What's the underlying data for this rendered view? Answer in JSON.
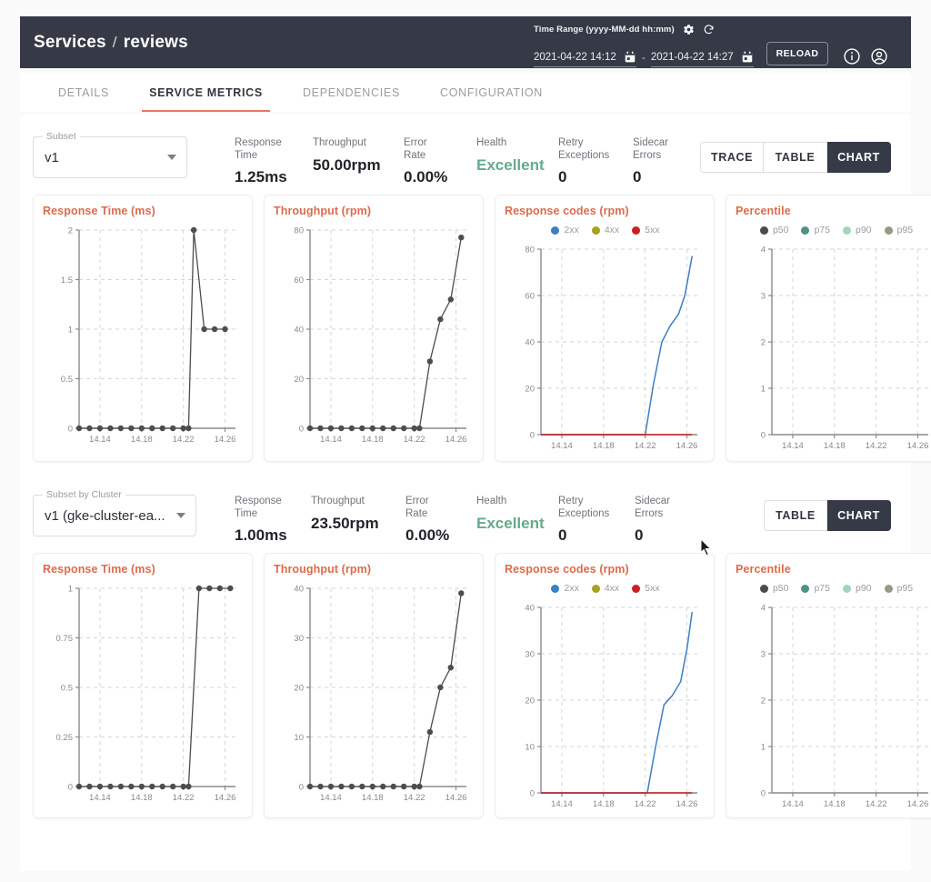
{
  "header": {
    "breadcrumb_root": "Services",
    "breadcrumb_sep": "/",
    "breadcrumb_current": "reviews",
    "time_range_label": "Time Range (yyyy-MM-dd hh:mm)",
    "date_from": "2021-04-22 14:12",
    "date_to": "2021-04-22 14:27",
    "dash": "-",
    "reload_label": "RELOAD",
    "icons": [
      "gear-icon",
      "refresh-icon",
      "calendar-icon",
      "info-icon",
      "account-icon"
    ]
  },
  "tabs": [
    {
      "label": "DETAILS",
      "active": false
    },
    {
      "label": "SERVICE METRICS",
      "active": true
    },
    {
      "label": "DEPENDENCIES",
      "active": false
    },
    {
      "label": "CONFIGURATION",
      "active": false
    }
  ],
  "section_subset": {
    "select_legend": "Subset",
    "select_value": "v1",
    "metrics": [
      {
        "label": "Response Time",
        "value": "1.25ms"
      },
      {
        "label": "Throughput",
        "value": "50.00rpm"
      },
      {
        "label": "Error Rate",
        "value": "0.00%"
      },
      {
        "label": "Health",
        "value": "Excellent"
      },
      {
        "label": "Retry Exceptions",
        "value": "0"
      },
      {
        "label": "Sidecar Errors",
        "value": "0"
      }
    ],
    "toggles": [
      {
        "label": "TRACE",
        "selected": false
      },
      {
        "label": "TABLE",
        "selected": false
      },
      {
        "label": "CHART",
        "selected": true
      }
    ]
  },
  "section_cluster": {
    "select_legend": "Subset by Cluster",
    "select_value": "v1 (gke-cluster-ea...",
    "metrics": [
      {
        "label": "Response Time",
        "value": "1.00ms"
      },
      {
        "label": "Throughput",
        "value": "23.50rpm"
      },
      {
        "label": "Error Rate",
        "value": "0.00%"
      },
      {
        "label": "Health",
        "value": "Excellent"
      },
      {
        "label": "Retry Exceptions",
        "value": "0"
      },
      {
        "label": "Sidecar Errors",
        "value": "0"
      }
    ],
    "toggles": [
      {
        "label": "TABLE",
        "selected": false
      },
      {
        "label": "CHART",
        "selected": true
      }
    ]
  },
  "colors": {
    "accent": "#dd6b4b",
    "topbar": "#363a47",
    "health": "#64ab8c",
    "series_dark": "#4d4d4d",
    "c2xx": "#3b7fc4",
    "c4xx": "#a8a020",
    "c5xx": "#cc2020",
    "p50": "#4d4a47",
    "p75": "#4f9283",
    "p90": "#9fd7b9",
    "p95": "#9b9885"
  },
  "chart_data": [
    {
      "id": "subset-response-time",
      "type": "line",
      "title": "Response Time (ms)",
      "xlabel": "",
      "ylabel": "ms",
      "ylim": [
        0,
        2
      ],
      "yticks": [
        0,
        0.5,
        1,
        1.5,
        2
      ],
      "xticks": [
        "14.14",
        "14.18",
        "14.22",
        "14.26"
      ],
      "xlim": [
        14.12,
        14.27
      ],
      "grid": true,
      "legend": [],
      "series": [
        {
          "name": "response time",
          "color": "#4d4d4d",
          "markers": true,
          "x": [
            14.12,
            14.13,
            14.14,
            14.15,
            14.16,
            14.17,
            14.18,
            14.19,
            14.2,
            14.21,
            14.22,
            14.225,
            14.23,
            14.24,
            14.25,
            14.26
          ],
          "values": [
            0,
            0,
            0,
            0,
            0,
            0,
            0,
            0,
            0,
            0,
            0,
            0,
            2,
            1,
            1,
            1
          ]
        }
      ]
    },
    {
      "id": "subset-throughput",
      "type": "line",
      "title": "Throughput (rpm)",
      "xlabel": "",
      "ylabel": "rpm",
      "ylim": [
        0,
        80
      ],
      "yticks": [
        0,
        20,
        40,
        60,
        80
      ],
      "xticks": [
        "14.14",
        "14.18",
        "14.22",
        "14.26"
      ],
      "xlim": [
        14.12,
        14.27
      ],
      "grid": true,
      "legend": [],
      "series": [
        {
          "name": "throughput",
          "color": "#4d4d4d",
          "markers": true,
          "x": [
            14.12,
            14.13,
            14.14,
            14.15,
            14.16,
            14.17,
            14.18,
            14.19,
            14.2,
            14.21,
            14.22,
            14.225,
            14.235,
            14.245,
            14.255,
            14.265
          ],
          "values": [
            0,
            0,
            0,
            0,
            0,
            0,
            0,
            0,
            0,
            0,
            0,
            0,
            27,
            44,
            52,
            77
          ]
        }
      ]
    },
    {
      "id": "subset-response-codes",
      "type": "line",
      "title": "Response codes (rpm)",
      "xlabel": "",
      "ylabel": "rpm",
      "ylim": [
        0,
        80
      ],
      "yticks": [
        0,
        20,
        40,
        60,
        80
      ],
      "xticks": [
        "14.14",
        "14.18",
        "14.22",
        "14.26"
      ],
      "xlim": [
        14.12,
        14.27
      ],
      "grid": true,
      "legend": [
        {
          "label": "2xx",
          "color": "#3b7fc4"
        },
        {
          "label": "4xx",
          "color": "#a8a020"
        },
        {
          "label": "5xx",
          "color": "#cc2020"
        }
      ],
      "series": [
        {
          "name": "2xx",
          "color": "#3b7fc4",
          "markers": false,
          "x": [
            14.12,
            14.21,
            14.22,
            14.228,
            14.236,
            14.244,
            14.252,
            14.258,
            14.265
          ],
          "values": [
            0,
            0,
            0,
            22,
            40,
            47,
            52,
            60,
            77
          ]
        },
        {
          "name": "5xx",
          "color": "#cc2020",
          "markers": false,
          "x": [
            14.12,
            14.265
          ],
          "values": [
            0,
            0
          ]
        }
      ]
    },
    {
      "id": "subset-percentile",
      "type": "line",
      "title": "Percentile",
      "xlabel": "",
      "ylabel": "",
      "ylim": [
        0,
        4
      ],
      "yticks": [
        0,
        1,
        2,
        3,
        4
      ],
      "xticks": [
        "14.14",
        "14.18",
        "14.22",
        "14.26"
      ],
      "xlim": [
        14.12,
        14.27
      ],
      "grid": true,
      "legend": [
        {
          "label": "p50",
          "color": "#4d4a47"
        },
        {
          "label": "p75",
          "color": "#4f9283"
        },
        {
          "label": "p90",
          "color": "#9fd7b9"
        },
        {
          "label": "p95",
          "color": "#9b9885"
        }
      ],
      "series": []
    },
    {
      "id": "cluster-response-time",
      "type": "line",
      "title": "Response Time (ms)",
      "xlabel": "",
      "ylabel": "ms",
      "ylim": [
        0,
        1
      ],
      "yticks": [
        0,
        0.25,
        0.5,
        0.75,
        1
      ],
      "xticks": [
        "14.14",
        "14.18",
        "14.22",
        "14.26"
      ],
      "xlim": [
        14.12,
        14.27
      ],
      "grid": true,
      "legend": [],
      "series": [
        {
          "name": "response time",
          "color": "#4d4d4d",
          "markers": true,
          "x": [
            14.12,
            14.13,
            14.14,
            14.15,
            14.16,
            14.17,
            14.18,
            14.19,
            14.2,
            14.21,
            14.22,
            14.225,
            14.235,
            14.245,
            14.255,
            14.265
          ],
          "values": [
            0,
            0,
            0,
            0,
            0,
            0,
            0,
            0,
            0,
            0,
            0,
            0,
            1,
            1,
            1,
            1
          ]
        }
      ]
    },
    {
      "id": "cluster-throughput",
      "type": "line",
      "title": "Throughput (rpm)",
      "xlabel": "",
      "ylabel": "rpm",
      "ylim": [
        0,
        40
      ],
      "yticks": [
        0,
        10,
        20,
        30,
        40
      ],
      "xticks": [
        "14.14",
        "14.18",
        "14.22",
        "14.26"
      ],
      "xlim": [
        14.12,
        14.27
      ],
      "grid": true,
      "legend": [],
      "series": [
        {
          "name": "throughput",
          "color": "#4d4d4d",
          "markers": true,
          "x": [
            14.12,
            14.13,
            14.14,
            14.15,
            14.16,
            14.17,
            14.18,
            14.19,
            14.2,
            14.21,
            14.22,
            14.225,
            14.235,
            14.245,
            14.255,
            14.265
          ],
          "values": [
            0,
            0,
            0,
            0,
            0,
            0,
            0,
            0,
            0,
            0,
            0,
            0,
            11,
            20,
            24,
            39
          ]
        }
      ]
    },
    {
      "id": "cluster-response-codes",
      "type": "line",
      "title": "Response codes (rpm)",
      "xlabel": "",
      "ylabel": "rpm",
      "ylim": [
        0,
        40
      ],
      "yticks": [
        0,
        10,
        20,
        30,
        40
      ],
      "xticks": [
        "14.14",
        "14.18",
        "14.22",
        "14.26"
      ],
      "xlim": [
        14.12,
        14.27
      ],
      "grid": true,
      "legend": [
        {
          "label": "2xx",
          "color": "#3b7fc4"
        },
        {
          "label": "4xx",
          "color": "#a8a020"
        },
        {
          "label": "5xx",
          "color": "#cc2020"
        }
      ],
      "series": [
        {
          "name": "2xx",
          "color": "#3b7fc4",
          "markers": false,
          "x": [
            14.12,
            14.21,
            14.222,
            14.23,
            14.238,
            14.246,
            14.254,
            14.26,
            14.265
          ],
          "values": [
            0,
            0,
            0,
            10,
            19,
            21,
            24,
            31,
            39
          ]
        },
        {
          "name": "5xx",
          "color": "#cc2020",
          "markers": false,
          "x": [
            14.12,
            14.265
          ],
          "values": [
            0,
            0
          ]
        }
      ]
    },
    {
      "id": "cluster-percentile",
      "type": "line",
      "title": "Percentile",
      "xlabel": "",
      "ylabel": "",
      "ylim": [
        0,
        4
      ],
      "yticks": [
        0,
        1,
        2,
        3,
        4
      ],
      "xticks": [
        "14.14",
        "14.18",
        "14.22",
        "14.26"
      ],
      "xlim": [
        14.12,
        14.27
      ],
      "grid": true,
      "legend": [
        {
          "label": "p50",
          "color": "#4d4a47"
        },
        {
          "label": "p75",
          "color": "#4f9283"
        },
        {
          "label": "p90",
          "color": "#9fd7b9"
        },
        {
          "label": "p95",
          "color": "#9b9885"
        }
      ],
      "series": []
    }
  ]
}
